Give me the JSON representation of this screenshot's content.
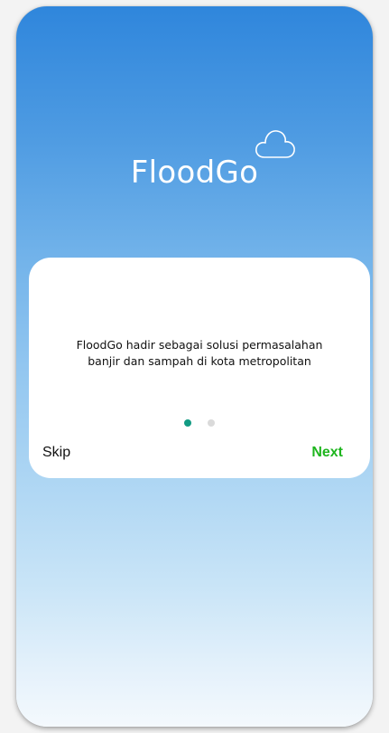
{
  "app": {
    "logo_text": "FloodGo",
    "logo_icon": "cloud-icon"
  },
  "onboarding": {
    "description_line1": "FloodGo hadir sebagai solusi permasalahan",
    "description_line2": "banjir dan sampah di kota metropolitan",
    "page_indicator": {
      "current": 1,
      "total": 2
    },
    "skip_label": "Skip",
    "next_label": "Next"
  },
  "colors": {
    "gradient_top": "#2f86dc",
    "gradient_bottom": "#f4f9fd",
    "indicator_active": "#129b83",
    "indicator_inactive": "#dadada",
    "next_text": "#1eb51e"
  }
}
